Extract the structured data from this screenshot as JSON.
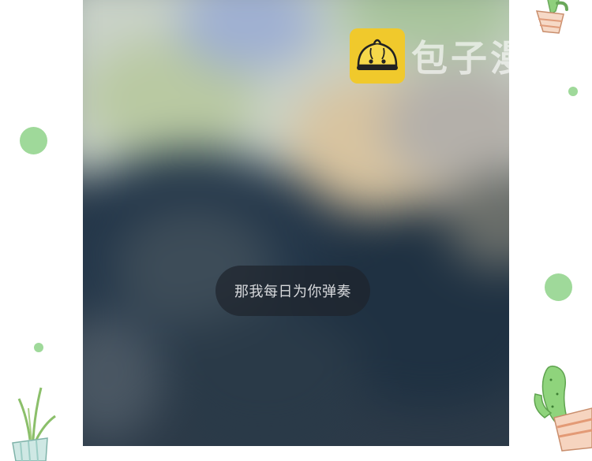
{
  "caption": {
    "text": "那我每日为你弹奏"
  },
  "watermark": {
    "brand_text": "包子漫畫",
    "logo_icon": "steamed-bun-icon"
  },
  "colors": {
    "page_background": "#ffffff",
    "dot_green": "#9fd99a",
    "logo_yellow": "#f0c92c",
    "caption_bubble": "#1e242c"
  },
  "decorations": {
    "top_right": "cactus-pot-icon",
    "bottom_right": "cactus-pot-icon",
    "bottom_left": "plant-pot-icon"
  }
}
